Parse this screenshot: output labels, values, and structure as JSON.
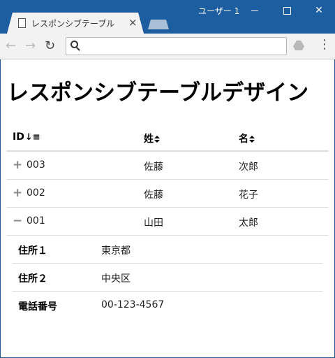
{
  "window": {
    "user": "ユーザー 1",
    "minimize_icon": "minimize-icon",
    "maximize_icon": "maximize-icon",
    "close_icon": "close-icon"
  },
  "tab": {
    "title": "レスポンシブテーブル",
    "close_glyph": "×"
  },
  "toolbar": {
    "back_glyph": "←",
    "forward_glyph": "→",
    "reload_glyph": "↻",
    "address_value": "",
    "menu_glyph": "⋮"
  },
  "page": {
    "title": "レスポンシブテーブルデザイン"
  },
  "table": {
    "headers": [
      {
        "label": "ID",
        "sort": "desc"
      },
      {
        "label": "姓",
        "sort": "both"
      },
      {
        "label": "名",
        "sort": "both"
      }
    ],
    "rows": [
      {
        "toggle": "+",
        "id": "003",
        "sei": "佐藤",
        "mei": "次郎",
        "expanded": false
      },
      {
        "toggle": "+",
        "id": "002",
        "sei": "佐藤",
        "mei": "花子",
        "expanded": false
      },
      {
        "toggle": "−",
        "id": "001",
        "sei": "山田",
        "mei": "太郎",
        "expanded": true
      }
    ],
    "details": [
      {
        "label": "住所１",
        "value": "東京都"
      },
      {
        "label": "住所２",
        "value": "中央区"
      },
      {
        "label": "電話番号",
        "value": "00-123-4567"
      }
    ]
  }
}
